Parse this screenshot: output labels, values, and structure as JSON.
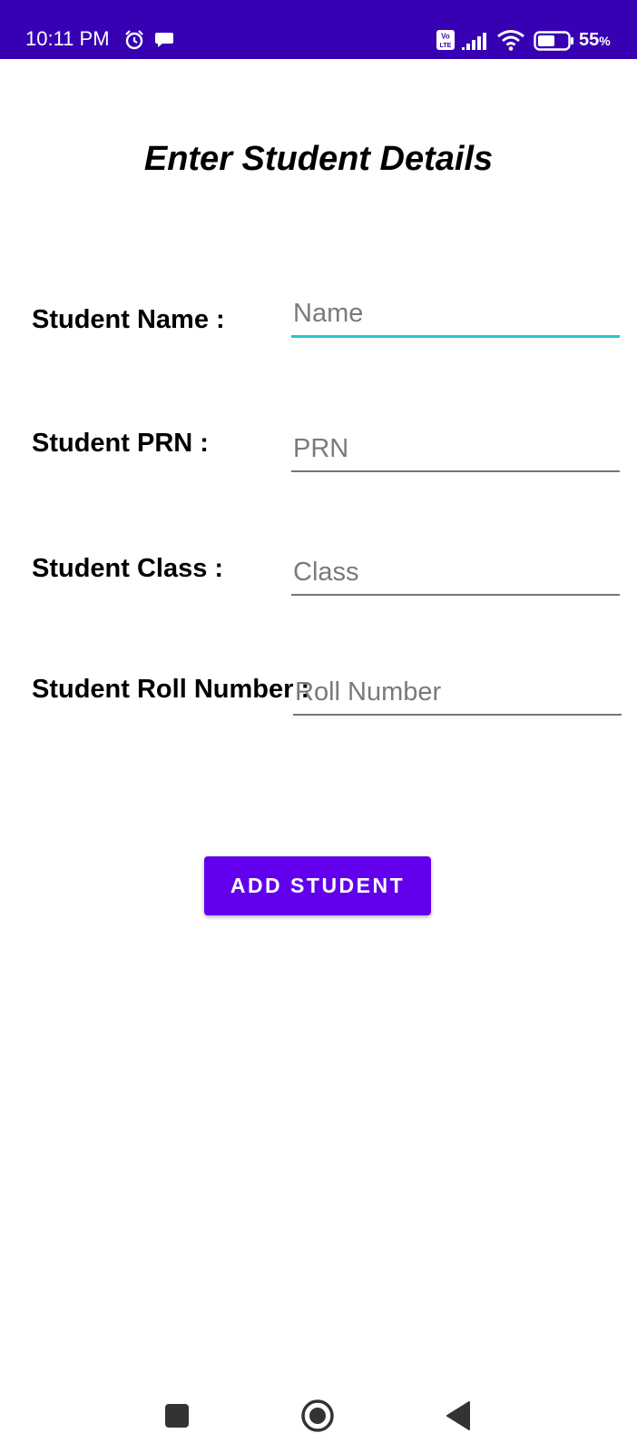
{
  "status_bar": {
    "time": "10:11 PM",
    "battery_percent": "55",
    "battery_unit": "%",
    "volte_top": "Vo",
    "volte_bottom": "LTE",
    "icons": [
      "alarm-icon",
      "chat-bubble-icon",
      "volte-icon",
      "signal-icon",
      "wifi-icon",
      "battery-icon"
    ]
  },
  "page": {
    "title": "Enter Student Details"
  },
  "form": {
    "name": {
      "label": "Student Name :",
      "placeholder": "Name",
      "value": ""
    },
    "prn": {
      "label": "Student PRN :",
      "placeholder": "PRN",
      "value": ""
    },
    "class": {
      "label": "Student Class :",
      "placeholder": "Class",
      "value": ""
    },
    "roll": {
      "label": "Student Roll Number :",
      "placeholder": "Roll Number",
      "value": ""
    }
  },
  "actions": {
    "add_label": "ADD STUDENT"
  },
  "nav_bar": {
    "icons": [
      "recents-square-icon",
      "home-circle-icon",
      "back-triangle-icon"
    ]
  },
  "colors": {
    "status_bar": "#3700b3",
    "primary": "#6200ee",
    "focus_underline": "#26c6c6"
  }
}
